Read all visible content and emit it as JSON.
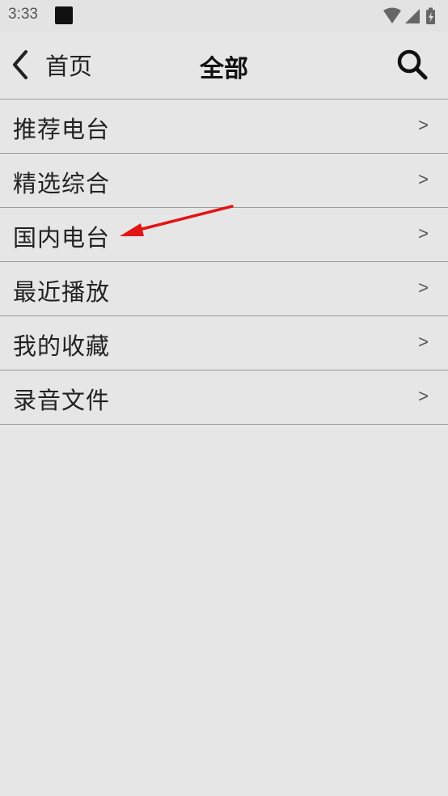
{
  "status_bar": {
    "time": "3:33",
    "icons": [
      "wifi-icon",
      "signal-icon",
      "battery-icon"
    ]
  },
  "header": {
    "back_label": "首页",
    "title": "全部",
    "search_icon": "search-icon"
  },
  "menu": {
    "items": [
      {
        "label": "推荐电台",
        "chevron": ">"
      },
      {
        "label": "精选综合",
        "chevron": ">"
      },
      {
        "label": "国内电台",
        "chevron": ">"
      },
      {
        "label": "最近播放",
        "chevron": ">"
      },
      {
        "label": "我的收藏",
        "chevron": ">"
      },
      {
        "label": "录音文件",
        "chevron": ">"
      }
    ]
  },
  "annotation": {
    "type": "arrow",
    "color": "#e31414",
    "points_to": "国内电台"
  },
  "colors": {
    "background": "#e6e6e6",
    "divider": "#9a9a9a",
    "text": "#222222",
    "arrow": "#e31414"
  }
}
